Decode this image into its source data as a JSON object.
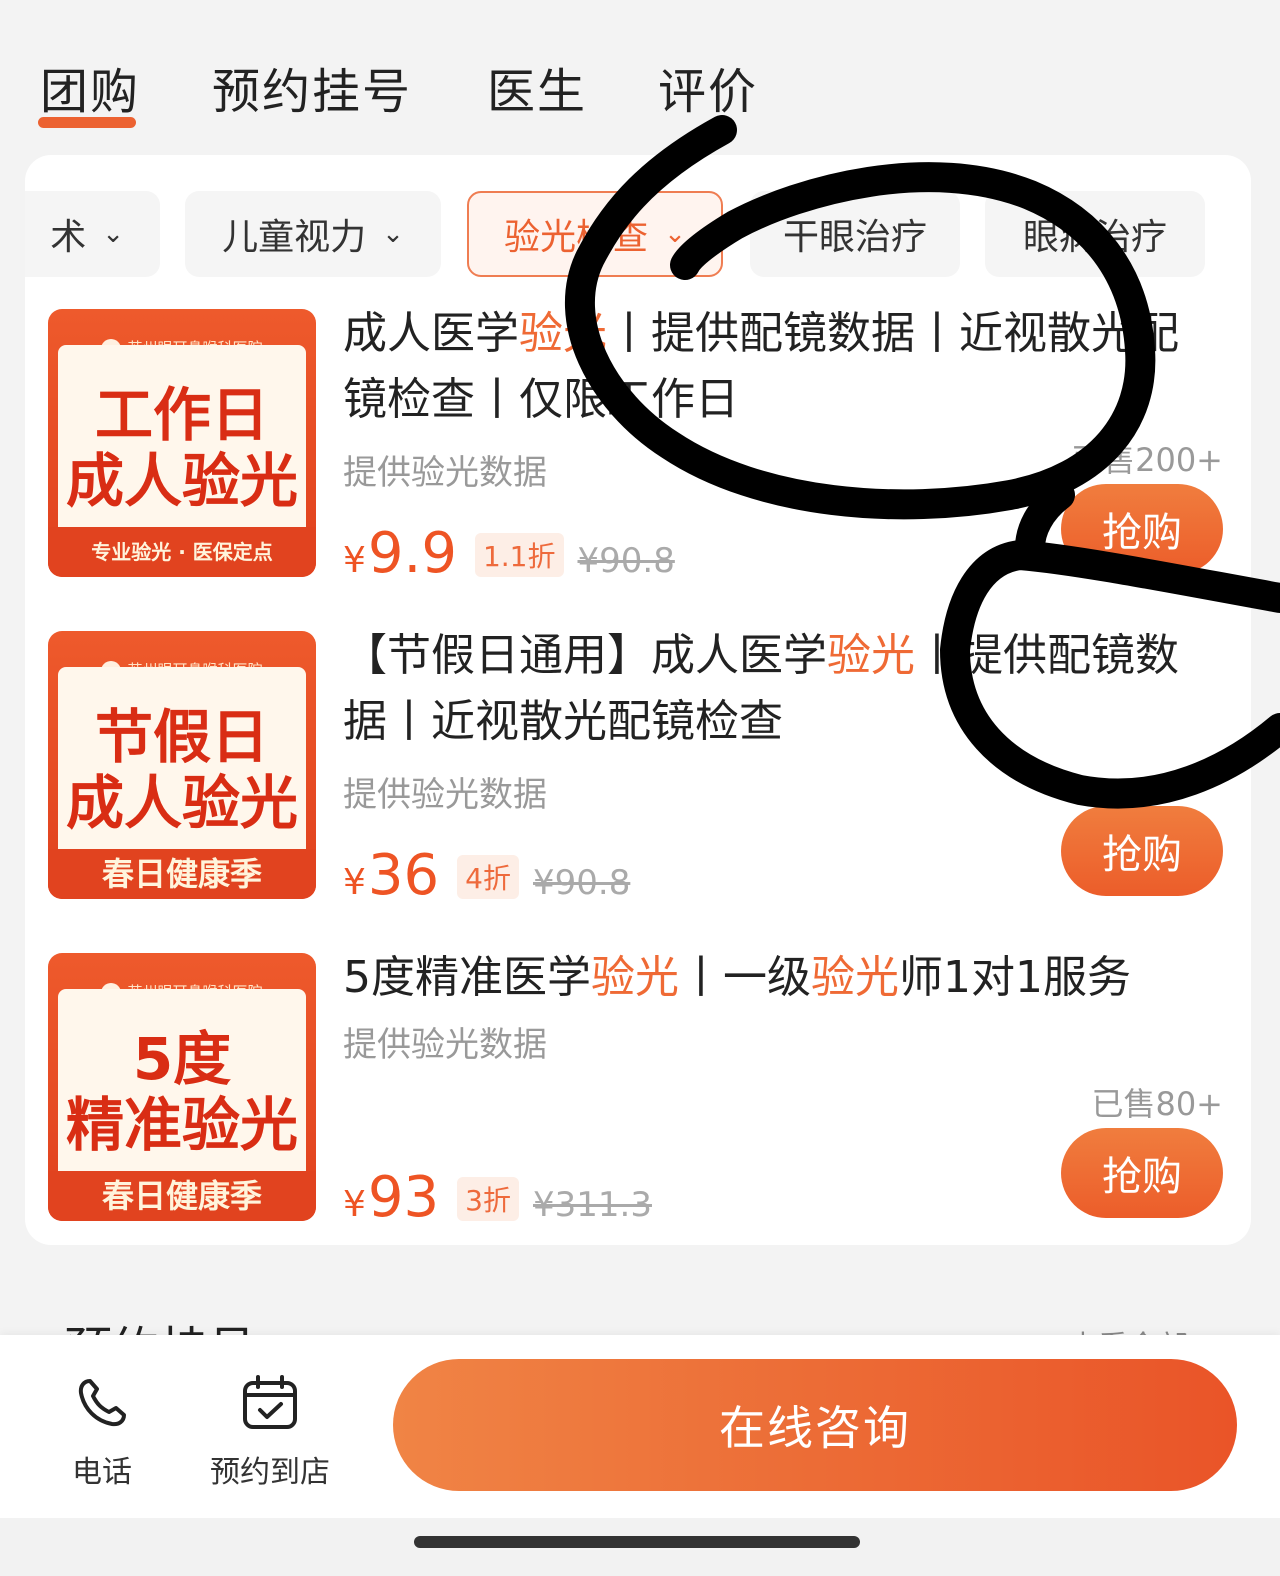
{
  "tabs": [
    {
      "label": "团购"
    },
    {
      "label": "预约挂号"
    },
    {
      "label": "医生"
    },
    {
      "label": "评价"
    }
  ],
  "chips": [
    {
      "label": "术"
    },
    {
      "label": "儿童视力"
    },
    {
      "label": "验光检查"
    },
    {
      "label": "干眼治疗"
    },
    {
      "label": "眼病治疗"
    }
  ],
  "products": [
    {
      "title_parts": [
        {
          "text": "成人医学",
          "hl": false
        },
        {
          "text": "验光",
          "hl": true
        },
        {
          "text": "丨提供配镜数据丨近视散光配镜检查丨仅限工作日",
          "hl": false
        }
      ],
      "subtitle": "提供验光数据",
      "price": "9.9",
      "discount": "1.1折",
      "original": "¥90.8",
      "sold": "已售200+",
      "buy_label": "抢购",
      "thumb": {
        "hospital": "苏州眼耳鼻喉科医院",
        "line1": "工作日",
        "line2": "成人验光",
        "band": "专业验光 · 医保定点"
      }
    },
    {
      "title_parts": [
        {
          "text": "【节假日通用】成人医学",
          "hl": false
        },
        {
          "text": "验光",
          "hl": true
        },
        {
          "text": "丨提供配镜数据丨近视散光配镜检查",
          "hl": false
        }
      ],
      "subtitle": "提供验光数据",
      "price": "36",
      "discount": "4折",
      "original": "¥90.8",
      "sold": "",
      "buy_label": "抢购",
      "thumb": {
        "hospital": "苏州眼耳鼻喉科医院",
        "line1": "节假日",
        "line2": "成人验光",
        "band": "春日健康季"
      }
    },
    {
      "title_parts": [
        {
          "text": "5度精准医学",
          "hl": false
        },
        {
          "text": "验光",
          "hl": true
        },
        {
          "text": "丨一级",
          "hl": false
        },
        {
          "text": "验光",
          "hl": true
        },
        {
          "text": "师1对1服务",
          "hl": false
        }
      ],
      "subtitle": "提供验光数据",
      "price": "93",
      "discount": "3折",
      "original": "¥311.3",
      "sold": "已售80+",
      "buy_label": "抢购",
      "thumb": {
        "hospital": "苏州眼耳鼻喉科医院",
        "line1": "5度",
        "line2": "精准验光",
        "band": "春日健康季"
      }
    }
  ],
  "currency": "¥",
  "section_peek": {
    "title": "预约挂号",
    "more": "查看全部"
  },
  "bottombar": {
    "phone_label": "电话",
    "visit_label": "预约到店",
    "consult_label": "在线咨询",
    "phone_icon": "phone-icon",
    "visit_icon": "calendar-check-icon"
  },
  "colors": {
    "accent": "#ec6231",
    "price": "#ee5424"
  }
}
